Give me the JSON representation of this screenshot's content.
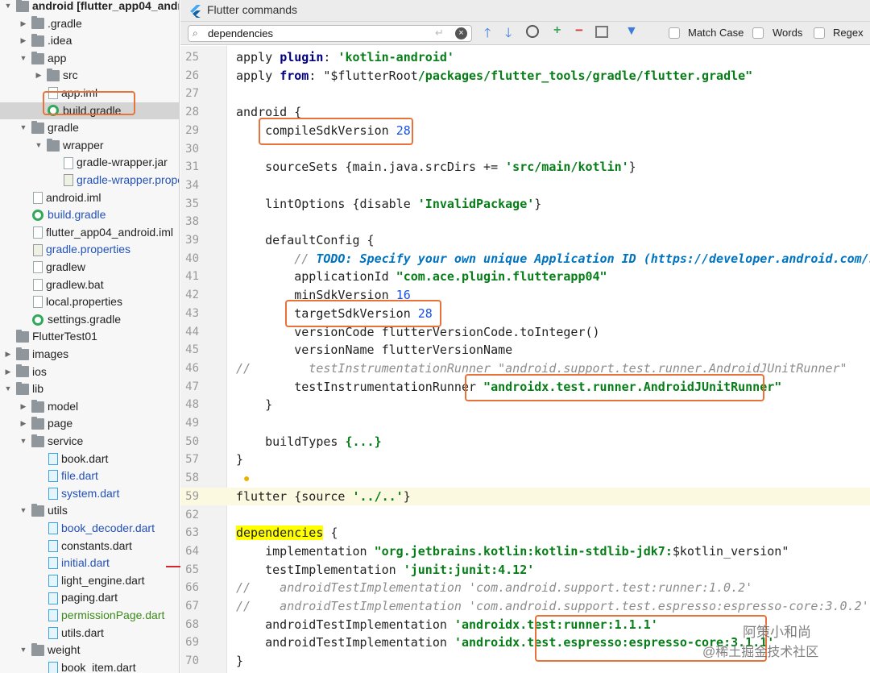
{
  "window": {
    "title": "Flutter commands"
  },
  "search": {
    "value": "dependencies",
    "match_case": "Match Case",
    "words": "Words",
    "regex": "Regex"
  },
  "tree": [
    {
      "label": "android [flutter_app04_android]",
      "indent": 0,
      "kind": "folder",
      "arrow": "open",
      "color": "normal"
    },
    {
      "label": ".gradle",
      "indent": 1,
      "kind": "folder",
      "arrow": "closed",
      "color": "normal"
    },
    {
      "label": ".idea",
      "indent": 1,
      "kind": "folder",
      "arrow": "closed",
      "color": "normal"
    },
    {
      "label": "app",
      "indent": 1,
      "kind": "folder",
      "arrow": "open",
      "color": "normal"
    },
    {
      "label": "src",
      "indent": 2,
      "kind": "folder",
      "arrow": "closed",
      "color": "normal"
    },
    {
      "label": "app.iml",
      "indent": 2,
      "kind": "file",
      "arrow": "none",
      "color": "normal"
    },
    {
      "label": "build.gradle",
      "indent": 2,
      "kind": "gradle",
      "arrow": "none",
      "color": "normal",
      "selected": true
    },
    {
      "label": "gradle",
      "indent": 1,
      "kind": "folder",
      "arrow": "open",
      "color": "normal"
    },
    {
      "label": "wrapper",
      "indent": 2,
      "kind": "folder",
      "arrow": "open",
      "color": "normal"
    },
    {
      "label": "gradle-wrapper.jar",
      "indent": 3,
      "kind": "file",
      "arrow": "none",
      "color": "normal"
    },
    {
      "label": "gradle-wrapper.properties",
      "indent": 3,
      "kind": "gradlef",
      "arrow": "none",
      "color": "blue"
    },
    {
      "label": "android.iml",
      "indent": 1,
      "kind": "file",
      "arrow": "none",
      "color": "normal"
    },
    {
      "label": "build.gradle",
      "indent": 1,
      "kind": "gradle",
      "arrow": "none",
      "color": "blue"
    },
    {
      "label": "flutter_app04_android.iml",
      "indent": 1,
      "kind": "file",
      "arrow": "none",
      "color": "normal"
    },
    {
      "label": "gradle.properties",
      "indent": 1,
      "kind": "gradlef",
      "arrow": "none",
      "color": "blue"
    },
    {
      "label": "gradlew",
      "indent": 1,
      "kind": "file",
      "arrow": "none",
      "color": "normal"
    },
    {
      "label": "gradlew.bat",
      "indent": 1,
      "kind": "file",
      "arrow": "none",
      "color": "normal"
    },
    {
      "label": "local.properties",
      "indent": 1,
      "kind": "file",
      "arrow": "none",
      "color": "normal"
    },
    {
      "label": "settings.gradle",
      "indent": 1,
      "kind": "gradle",
      "arrow": "none",
      "color": "normal"
    },
    {
      "label": "FlutterTest01",
      "indent": 0,
      "kind": "folder",
      "arrow": "none",
      "color": "normal"
    },
    {
      "label": "images",
      "indent": 0,
      "kind": "folder",
      "arrow": "closed",
      "color": "normal"
    },
    {
      "label": "ios",
      "indent": 0,
      "kind": "folder",
      "arrow": "closed",
      "color": "normal"
    },
    {
      "label": "lib",
      "indent": 0,
      "kind": "folder",
      "arrow": "open",
      "color": "normal"
    },
    {
      "label": "model",
      "indent": 1,
      "kind": "folder",
      "arrow": "closed",
      "color": "normal"
    },
    {
      "label": "page",
      "indent": 1,
      "kind": "folder",
      "arrow": "closed",
      "color": "normal"
    },
    {
      "label": "service",
      "indent": 1,
      "kind": "folder",
      "arrow": "open",
      "color": "normal"
    },
    {
      "label": "book.dart",
      "indent": 2,
      "kind": "dart",
      "arrow": "none",
      "color": "normal"
    },
    {
      "label": "file.dart",
      "indent": 2,
      "kind": "dart",
      "arrow": "none",
      "color": "blue"
    },
    {
      "label": "system.dart",
      "indent": 2,
      "kind": "dart",
      "arrow": "none",
      "color": "blue"
    },
    {
      "label": "utils",
      "indent": 1,
      "kind": "folder",
      "arrow": "open",
      "color": "normal"
    },
    {
      "label": "book_decoder.dart",
      "indent": 2,
      "kind": "dart",
      "arrow": "none",
      "color": "blue"
    },
    {
      "label": "constants.dart",
      "indent": 2,
      "kind": "dart",
      "arrow": "none",
      "color": "normal"
    },
    {
      "label": "initial.dart",
      "indent": 2,
      "kind": "dart",
      "arrow": "none",
      "color": "blue"
    },
    {
      "label": "light_engine.dart",
      "indent": 2,
      "kind": "dart",
      "arrow": "none",
      "color": "normal"
    },
    {
      "label": "paging.dart",
      "indent": 2,
      "kind": "dart",
      "arrow": "none",
      "color": "normal"
    },
    {
      "label": "permissionPage.dart",
      "indent": 2,
      "kind": "dart",
      "arrow": "none",
      "color": "green"
    },
    {
      "label": "utils.dart",
      "indent": 2,
      "kind": "dart",
      "arrow": "none",
      "color": "normal"
    },
    {
      "label": "weight",
      "indent": 1,
      "kind": "folder",
      "arrow": "open",
      "color": "normal"
    },
    {
      "label": "book_item.dart",
      "indent": 2,
      "kind": "dart",
      "arrow": "none",
      "color": "normal"
    }
  ],
  "code_lines": [
    {
      "n": "25",
      "segs": [
        [
          "apply ",
          ""
        ],
        [
          "plugin",
          "kw"
        ],
        [
          ": ",
          ""
        ],
        [
          "'kotlin-android'",
          "str"
        ]
      ]
    },
    {
      "n": "26",
      "segs": [
        [
          "apply ",
          ""
        ],
        [
          "from",
          "kw"
        ],
        [
          ": \"$flutterRoot",
          ""
        ],
        [
          "/packages/flutter_tools/gradle/flutter.gradle\"",
          "str"
        ]
      ]
    },
    {
      "n": "27",
      "segs": []
    },
    {
      "n": "28",
      "segs": [
        [
          "android {",
          ""
        ]
      ]
    },
    {
      "n": "29",
      "segs": [
        [
          "    compileSdkVersion ",
          ""
        ],
        [
          "28",
          "num"
        ]
      ]
    },
    {
      "n": "30",
      "segs": []
    },
    {
      "n": "31",
      "segs": [
        [
          "    sourceSets {main.java.srcDirs += ",
          ""
        ],
        [
          "'src/main/kotlin'",
          "str"
        ],
        [
          "}",
          ""
        ]
      ]
    },
    {
      "n": "34",
      "segs": []
    },
    {
      "n": "35",
      "segs": [
        [
          "    lintOptions {disable ",
          ""
        ],
        [
          "'InvalidPackage'",
          "str"
        ],
        [
          "}",
          ""
        ]
      ]
    },
    {
      "n": "38",
      "segs": []
    },
    {
      "n": "39",
      "segs": [
        [
          "    defaultConfig {",
          ""
        ]
      ]
    },
    {
      "n": "40",
      "segs": [
        [
          "        // ",
          "cmt"
        ],
        [
          "TODO: Specify your own unique Application ID (https://developer.android.com/stud",
          "todo"
        ]
      ]
    },
    {
      "n": "41",
      "segs": [
        [
          "        applicationId ",
          ""
        ],
        [
          "\"com.ace.plugin.flutterapp04\"",
          "str"
        ]
      ]
    },
    {
      "n": "42",
      "segs": [
        [
          "        minSdkVersion ",
          ""
        ],
        [
          "16",
          "num"
        ]
      ]
    },
    {
      "n": "43",
      "segs": [
        [
          "        targetSdkVersion ",
          ""
        ],
        [
          "28",
          "num"
        ]
      ]
    },
    {
      "n": "44",
      "segs": [
        [
          "        versionCode flutterVersionCode.toInteger()",
          ""
        ]
      ]
    },
    {
      "n": "45",
      "segs": [
        [
          "        versionName flutterVersionName",
          ""
        ]
      ]
    },
    {
      "n": "46",
      "segs": [
        [
          "//        testInstrumentationRunner \"android.support.test.runner.AndroidJUnitRunner\"",
          "cmt"
        ]
      ]
    },
    {
      "n": "47",
      "segs": [
        [
          "        testInstrumentationRunner ",
          ""
        ],
        [
          "\"androidx.test.runner.AndroidJUnitRunner\"",
          "str"
        ]
      ]
    },
    {
      "n": "48",
      "segs": [
        [
          "    }",
          ""
        ]
      ]
    },
    {
      "n": "49",
      "segs": []
    },
    {
      "n": "50",
      "segs": [
        [
          "    buildTypes ",
          ""
        ],
        [
          "{...}",
          "str"
        ]
      ]
    },
    {
      "n": "57",
      "segs": [
        [
          "}",
          ""
        ]
      ]
    },
    {
      "n": "58",
      "segs": []
    },
    {
      "n": "59",
      "segs": [
        [
          "flutter {source ",
          ""
        ],
        [
          "'../..'",
          "str"
        ],
        [
          "}",
          ""
        ]
      ]
    },
    {
      "n": "62",
      "segs": []
    },
    {
      "n": "63",
      "segs": [
        [
          "dependencies",
          "hl"
        ],
        [
          " {",
          ""
        ]
      ]
    },
    {
      "n": "64",
      "segs": [
        [
          "    implementation ",
          ""
        ],
        [
          "\"org.jetbrains.kotlin:kotlin-stdlib-jdk7:",
          "str"
        ],
        [
          "$kotlin_version\"",
          ""
        ]
      ]
    },
    {
      "n": "65",
      "segs": [
        [
          "    testImplementation ",
          ""
        ],
        [
          "'junit:junit:4.12'",
          "str"
        ]
      ]
    },
    {
      "n": "66",
      "segs": [
        [
          "//    androidTestImplementation 'com.android.support.test:runner:1.0.2'",
          "cmt"
        ]
      ]
    },
    {
      "n": "67",
      "segs": [
        [
          "//    androidTestImplementation 'com.android.support.test.espresso:espresso-core:3.0.2'",
          "cmt"
        ]
      ]
    },
    {
      "n": "68",
      "segs": [
        [
          "    androidTestImplementation ",
          ""
        ],
        [
          "'androidx.test:runner:1.1.1'",
          "str"
        ]
      ]
    },
    {
      "n": "69",
      "segs": [
        [
          "    androidTestImplementation ",
          ""
        ],
        [
          "'androidx.test.espresso:espresso-core:3.1.1'",
          "str"
        ]
      ]
    },
    {
      "n": "70",
      "segs": [
        [
          "}",
          ""
        ]
      ]
    }
  ],
  "watermark": "@稀土掘金技术社区",
  "watermark2": "阿策小和尚",
  "colors": {
    "highlight_box": "#e8733a",
    "search_hit": "#ffff00",
    "string": "#067d17",
    "keyword": "#000080"
  }
}
